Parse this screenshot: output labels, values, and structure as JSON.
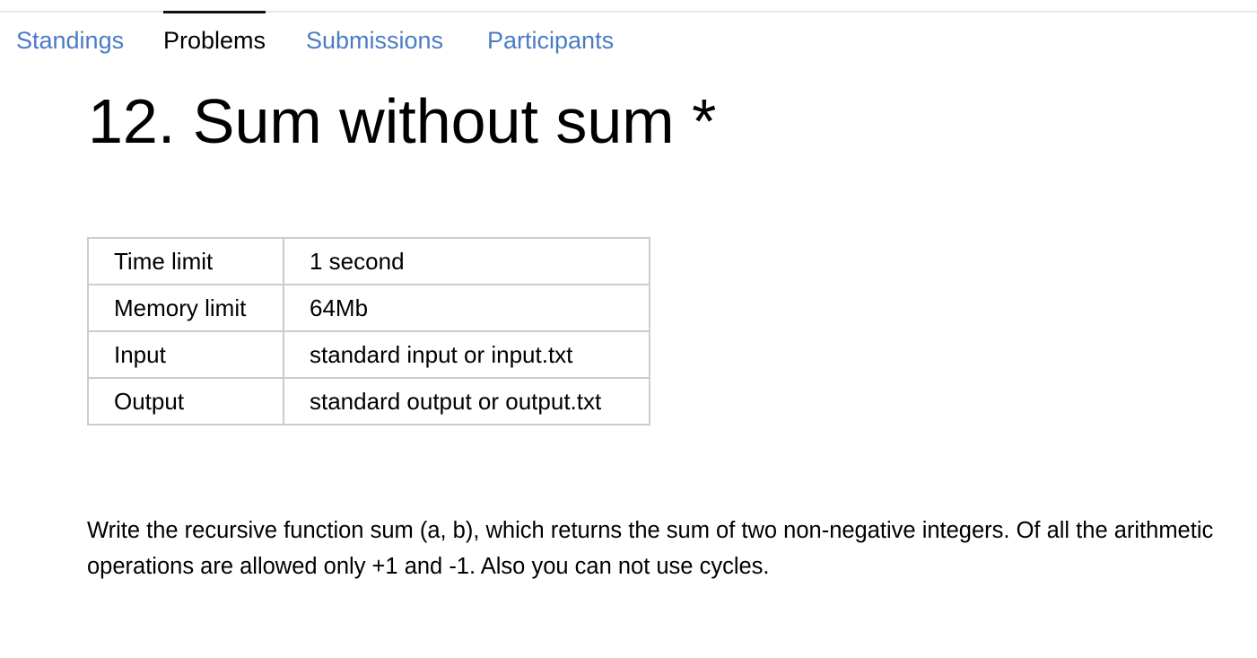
{
  "nav": {
    "tabs": [
      {
        "label": "Standings",
        "active": false
      },
      {
        "label": "Problems",
        "active": true
      },
      {
        "label": "Submissions",
        "active": false
      },
      {
        "label": "Participants",
        "active": false
      }
    ]
  },
  "problem": {
    "title": "12. Sum without sum *",
    "limits": [
      {
        "label": "Time limit",
        "value": "1 second"
      },
      {
        "label": "Memory limit",
        "value": "64Mb"
      },
      {
        "label": "Input",
        "value": "standard input or input.txt"
      },
      {
        "label": "Output",
        "value": "standard output or output.txt"
      }
    ],
    "statement": "Write the recursive function sum (a, b), which returns the sum of two non-negative integers. Of all the arithmetic operations are allowed only +1 and -1. Also you can not use cycles."
  },
  "colors": {
    "link": "#4a7cc4",
    "active_tab_text": "#000000",
    "active_tab_indicator": "#111111",
    "table_border": "#cccccc",
    "top_rule": "#e6e6e6"
  }
}
